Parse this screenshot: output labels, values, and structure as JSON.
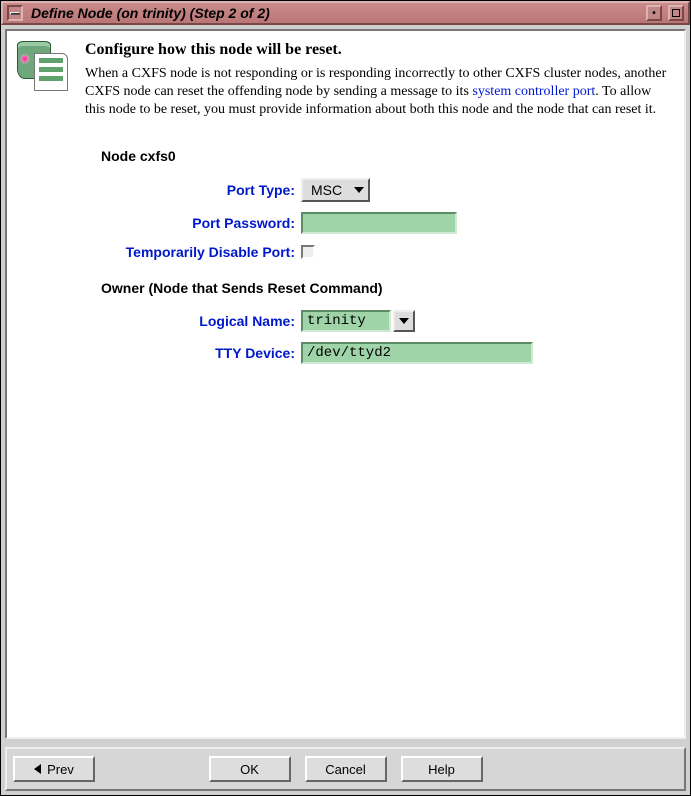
{
  "titlebar": {
    "title": "Define Node (on trinity) (Step 2 of 2)"
  },
  "intro": {
    "heading": "Configure how this node will be reset.",
    "text_before_link": "When a CXFS node is not responding or is responding incorrectly to other CXFS cluster nodes, another CXFS node can reset the offending node by sending a message to its ",
    "link_text": "system controller port",
    "text_after_link": ".  To allow this node to be reset, you must provide information about both this node and the node that can reset it."
  },
  "node_section": {
    "title": "Node cxfs0",
    "port_type": {
      "label": "Port Type:",
      "value": "MSC"
    },
    "port_password": {
      "label": "Port Password:",
      "value": ""
    },
    "disable_port": {
      "label": "Temporarily Disable Port:",
      "checked": false
    }
  },
  "owner_section": {
    "title": "Owner (Node that Sends Reset Command)",
    "logical_name": {
      "label": "Logical Name:",
      "value": "trinity"
    },
    "tty_device": {
      "label": "TTY Device:",
      "value": "/dev/ttyd2"
    }
  },
  "buttons": {
    "prev": "Prev",
    "ok": "OK",
    "cancel": "Cancel",
    "help": "Help"
  }
}
